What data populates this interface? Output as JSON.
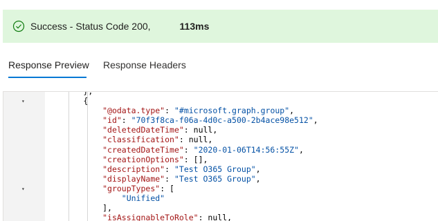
{
  "banner": {
    "status": "Success - Status Code 200,",
    "duration": "113ms",
    "color": "#dff6dd"
  },
  "tabs": [
    {
      "label": "Response Preview",
      "active": true
    },
    {
      "label": "Response Headers",
      "active": false
    }
  ],
  "editor": {
    "lines": [
      {
        "fold": false,
        "indent": "    ",
        "parts": [
          {
            "t": "p",
            "v": "},"
          }
        ]
      },
      {
        "fold": true,
        "indent": "    ",
        "parts": [
          {
            "t": "p",
            "v": "{"
          }
        ]
      },
      {
        "fold": false,
        "indent": "        ",
        "parts": [
          {
            "t": "k",
            "v": "\"@odata.type\""
          },
          {
            "t": "p",
            "v": ": "
          },
          {
            "t": "s",
            "v": "\"#microsoft.graph.group\""
          },
          {
            "t": "p",
            "v": ","
          }
        ]
      },
      {
        "fold": false,
        "indent": "        ",
        "parts": [
          {
            "t": "k",
            "v": "\"id\""
          },
          {
            "t": "p",
            "v": ": "
          },
          {
            "t": "s",
            "v": "\"70f3f8ca-f06a-4d0c-a500-2b4ace98e512\""
          },
          {
            "t": "p",
            "v": ","
          }
        ]
      },
      {
        "fold": false,
        "indent": "        ",
        "parts": [
          {
            "t": "k",
            "v": "\"deletedDateTime\""
          },
          {
            "t": "p",
            "v": ": null,"
          }
        ]
      },
      {
        "fold": false,
        "indent": "        ",
        "parts": [
          {
            "t": "k",
            "v": "\"classification\""
          },
          {
            "t": "p",
            "v": ": null,"
          }
        ]
      },
      {
        "fold": false,
        "indent": "        ",
        "parts": [
          {
            "t": "k",
            "v": "\"createdDateTime\""
          },
          {
            "t": "p",
            "v": ": "
          },
          {
            "t": "s",
            "v": "\"2020-01-06T14:56:55Z\""
          },
          {
            "t": "p",
            "v": ","
          }
        ]
      },
      {
        "fold": false,
        "indent": "        ",
        "parts": [
          {
            "t": "k",
            "v": "\"creationOptions\""
          },
          {
            "t": "p",
            "v": ": [],"
          }
        ]
      },
      {
        "fold": false,
        "indent": "        ",
        "parts": [
          {
            "t": "k",
            "v": "\"description\""
          },
          {
            "t": "p",
            "v": ": "
          },
          {
            "t": "s",
            "v": "\"Test O365 Group\""
          },
          {
            "t": "p",
            "v": ","
          }
        ]
      },
      {
        "fold": false,
        "indent": "        ",
        "parts": [
          {
            "t": "k",
            "v": "\"displayName\""
          },
          {
            "t": "p",
            "v": ": "
          },
          {
            "t": "s",
            "v": "\"Test O365 Group\""
          },
          {
            "t": "p",
            "v": ","
          }
        ]
      },
      {
        "fold": true,
        "indent": "        ",
        "parts": [
          {
            "t": "k",
            "v": "\"groupTypes\""
          },
          {
            "t": "p",
            "v": ": ["
          }
        ]
      },
      {
        "fold": false,
        "indent": "            ",
        "parts": [
          {
            "t": "s",
            "v": "\"Unified\""
          }
        ]
      },
      {
        "fold": false,
        "indent": "        ",
        "parts": [
          {
            "t": "p",
            "v": "],"
          }
        ]
      },
      {
        "fold": false,
        "indent": "        ",
        "parts": [
          {
            "t": "k",
            "v": "\"isAssignableToRole\""
          },
          {
            "t": "p",
            "v": ": null,"
          }
        ]
      }
    ]
  }
}
